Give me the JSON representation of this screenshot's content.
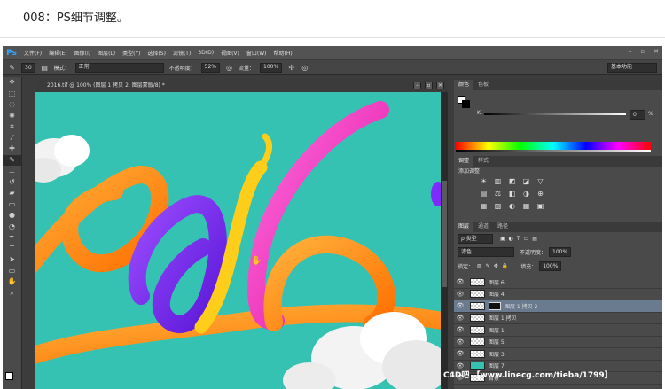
{
  "step_title": "008：PS细节调整。",
  "app": {
    "logo": "Ps",
    "menu": [
      "文件(F)",
      "编辑(E)",
      "图像(I)",
      "图层(L)",
      "类型(Y)",
      "选择(S)",
      "滤镜(T)",
      "3D(D)",
      "视图(V)",
      "窗口(W)",
      "帮助(H)"
    ],
    "window_controls": [
      "–",
      "▫",
      "✕"
    ]
  },
  "options_bar": {
    "brush_size": "30",
    "mode_label": "模式：",
    "mode_value": "正常",
    "opacity_label": "不透明度：",
    "opacity_value": "52%",
    "flow_label": "流量：",
    "flow_value": "100%",
    "workspace": "基本功能"
  },
  "document": {
    "tab_title": "2016.tif @ 100% (图层 1 拷贝 2, 图层蒙版/8) *",
    "controls": [
      "–",
      "▫",
      "✕"
    ]
  },
  "color_panel": {
    "tabs": [
      "颜色",
      "色板"
    ],
    "channel_label": "K",
    "value": "0",
    "unit": "%"
  },
  "adjustments_panel": {
    "tabs": [
      "调整",
      "样式"
    ],
    "add_label": "添加调整",
    "icons": [
      "☀",
      "▥",
      "◩",
      "◪",
      "▽",
      "▤",
      "⚖",
      "◧",
      "◑",
      "⊕",
      "▦",
      "▨",
      "◐",
      "▦",
      "▣"
    ]
  },
  "layers_panel": {
    "tabs": [
      "图层",
      "通道",
      "路径"
    ],
    "kind_filter": "ρ 类型",
    "blend_mode": "滤色",
    "opacity_label": "不透明度：",
    "opacity_value": "100%",
    "lock_label": "锁定：",
    "fill_label": "填充：",
    "fill_value": "100%",
    "layers": [
      {
        "name": "图层 6",
        "selected": false,
        "teal": false,
        "mask": false
      },
      {
        "name": "图层 4",
        "selected": false,
        "teal": false,
        "mask": false
      },
      {
        "name": "图层 1 拷贝 2",
        "selected": true,
        "teal": false,
        "mask": true
      },
      {
        "name": "图层 1 拷贝",
        "selected": false,
        "teal": false,
        "mask": false
      },
      {
        "name": "图层 1",
        "selected": false,
        "teal": false,
        "mask": false
      },
      {
        "name": "图层 5",
        "selected": false,
        "teal": false,
        "mask": false
      },
      {
        "name": "图层 3",
        "selected": false,
        "teal": false,
        "mask": false
      },
      {
        "name": "图层 7",
        "selected": false,
        "teal": true,
        "mask": false
      },
      {
        "name": "背景",
        "selected": false,
        "teal": false,
        "mask": false
      }
    ]
  },
  "watermark": "C4D吧 【www.linecg.com/tieba/1799】",
  "colors": {
    "canvas_bg": "#36c2b2",
    "ribbon_orange": "#ff8a12",
    "ribbon_purple": "#7d2bff",
    "ribbon_yellow": "#ffd21a",
    "ribbon_pink": "#ff2cc8"
  }
}
